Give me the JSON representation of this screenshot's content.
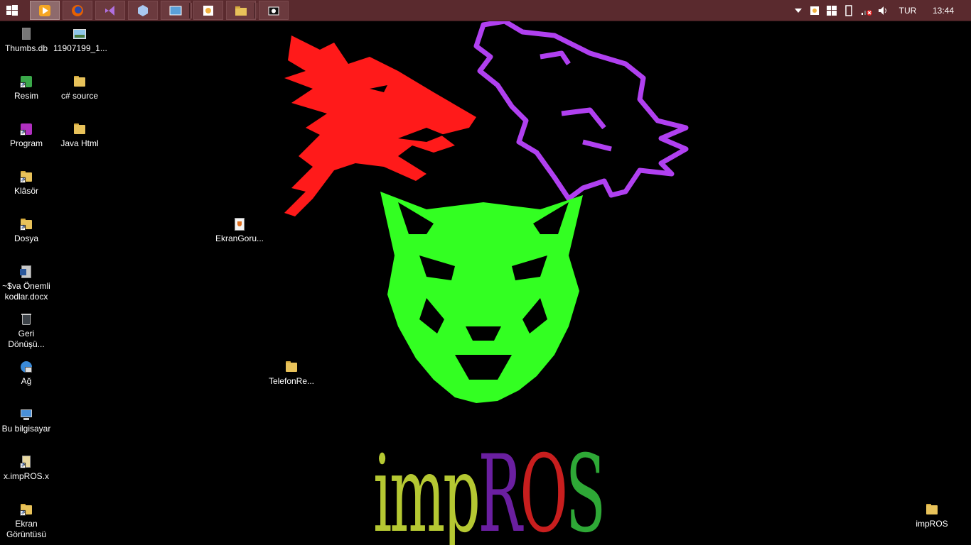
{
  "taskbar": {
    "start_icon": "windows-logo-icon",
    "pinned": [
      {
        "name": "media-player-icon",
        "color": "#f5a623",
        "active": true
      },
      {
        "name": "firefox-icon",
        "color": "#e66000",
        "active": false
      },
      {
        "name": "visual-studio-icon",
        "color": "#68217a",
        "active": false
      },
      {
        "name": "virtualbox-icon",
        "color": "#a8c8f0",
        "active": false
      },
      {
        "name": "remote-desktop-icon",
        "color": "#5aa0d8",
        "active": false
      },
      {
        "name": "paint-icon",
        "color": "#f0b040",
        "active": false
      },
      {
        "name": "file-explorer-icon",
        "color": "#e8c25a",
        "active": false
      },
      {
        "name": "camera-icon",
        "color": "#ffffff",
        "active": false
      }
    ],
    "tray": {
      "language": "TUR",
      "time": "13:44"
    }
  },
  "desktop_icons": [
    {
      "label": "Thumbs.db",
      "icon": "thumbs-db-icon"
    },
    {
      "label": "11907199_1...",
      "icon": "image-file-icon"
    },
    {
      "label": "Resim",
      "icon": "resim-shortcut-icon"
    },
    {
      "label": "c# source",
      "icon": "folder-icon"
    },
    {
      "label": "Program",
      "icon": "program-shortcut-icon"
    },
    {
      "label": "Java Html",
      "icon": "folder-icon"
    },
    {
      "label": "Klâsör",
      "icon": "folder-shortcut-icon"
    },
    {
      "label": "Dosya",
      "icon": "folder-shortcut-icon"
    },
    {
      "label": "EkranGoru...",
      "icon": "java-file-icon"
    },
    {
      "label": "~$va Önemli\nkodlar.docx",
      "icon": "word-document-icon"
    },
    {
      "label": "Geri\nDönüşü...",
      "icon": "recycle-bin-icon"
    },
    {
      "label": "TelefonRe...",
      "icon": "folder-icon"
    },
    {
      "label": "Ağ",
      "icon": "network-icon"
    },
    {
      "label": "Bu bilgisayar",
      "icon": "computer-icon"
    },
    {
      "label": "x.impROS.x",
      "icon": "file-shortcut-icon"
    },
    {
      "label": "Ekran\nGörüntüsü",
      "icon": "folder-shortcut-icon"
    },
    {
      "label": "impROS",
      "icon": "folder-icon"
    }
  ],
  "wallpaper": {
    "logo_parts": [
      {
        "text": "imp",
        "color": "#b5c832"
      },
      {
        "text": "R",
        "color": "#6a1fa0"
      },
      {
        "text": "O",
        "color": "#c81e1e"
      },
      {
        "text": "S",
        "color": "#2ea836"
      }
    ],
    "colors": {
      "red_wolf": "#ff1a1a",
      "purple_wolf": "#b040f0",
      "green_wolf": "#33ff22"
    }
  }
}
